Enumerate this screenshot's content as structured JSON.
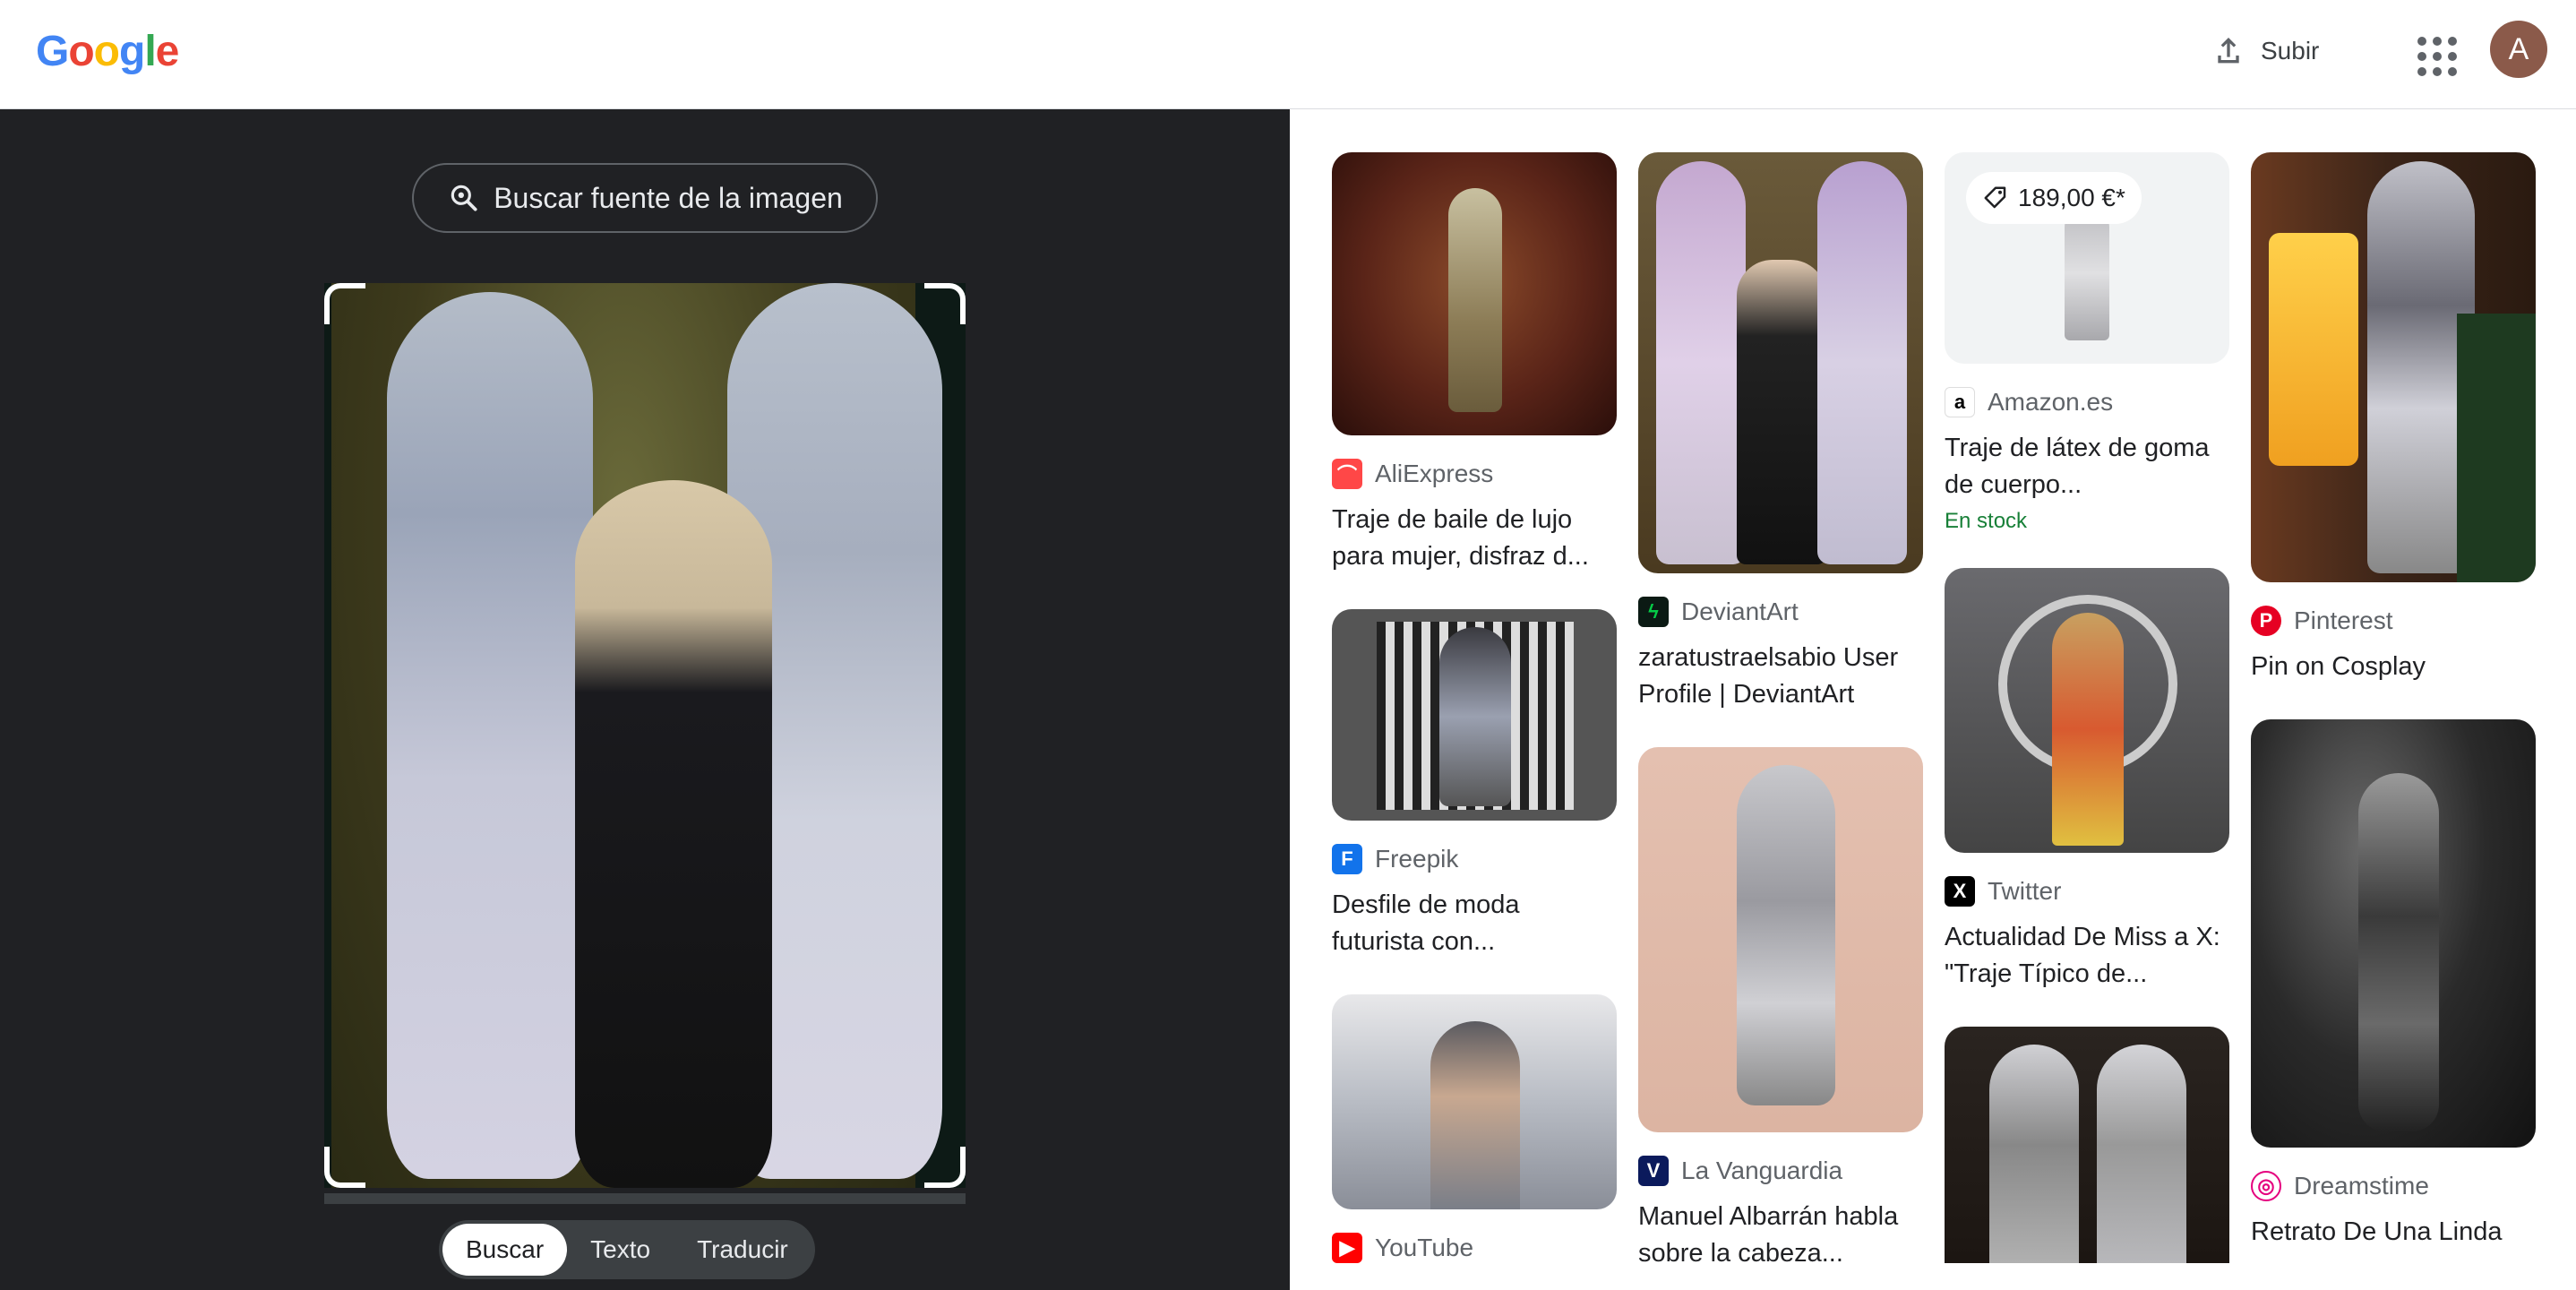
{
  "header": {
    "logo": "Google",
    "upload_label": "Subir",
    "apps_icon": "apps-grid-icon",
    "avatar_initial": "A"
  },
  "lens": {
    "source_button": "Buscar fuente de la imagen",
    "tabs": [
      {
        "label": "Buscar",
        "active": true
      },
      {
        "label": "Texto",
        "active": false
      },
      {
        "label": "Traducir",
        "active": false
      }
    ]
  },
  "results": {
    "col1": [
      {
        "source": "AliExpress",
        "fav_color": "#ff4747",
        "title": "Traje de baile de lujo para mujer, disfraz d..."
      },
      {
        "source": "Freepik",
        "fav_color": "#1273eb",
        "title": "Desfile de moda futurista con..."
      },
      {
        "source": "YouTube",
        "fav_color": "#ff0000",
        "title": ""
      }
    ],
    "col2": [
      {
        "source": "DeviantArt",
        "fav_color": "#05cc47",
        "title": "zaratustraelsabio User Profile | DeviantArt"
      },
      {
        "source": "La Vanguardia",
        "fav_color": "#0b1a5c",
        "title": "Manuel Albarrán habla sobre la cabeza..."
      }
    ],
    "col3": [
      {
        "source": "Amazon.es",
        "fav_color": "#ff9900",
        "title": "Traje de látex de goma de cuerpo...",
        "stock": "En stock",
        "price": "189,00 €*"
      },
      {
        "source": "Twitter",
        "fav_color": "#000000",
        "title": "Actualidad De Miss a X: \"Traje Típico de..."
      },
      {
        "source": "",
        "fav_color": "",
        "title": ""
      }
    ],
    "col4": [
      {
        "source": "Pinterest",
        "fav_color": "#e60023",
        "title": "Pin on Cosplay"
      },
      {
        "source": "Dreamstime",
        "fav_color": "#e5007e",
        "title": "Retrato De Una Linda"
      }
    ]
  }
}
